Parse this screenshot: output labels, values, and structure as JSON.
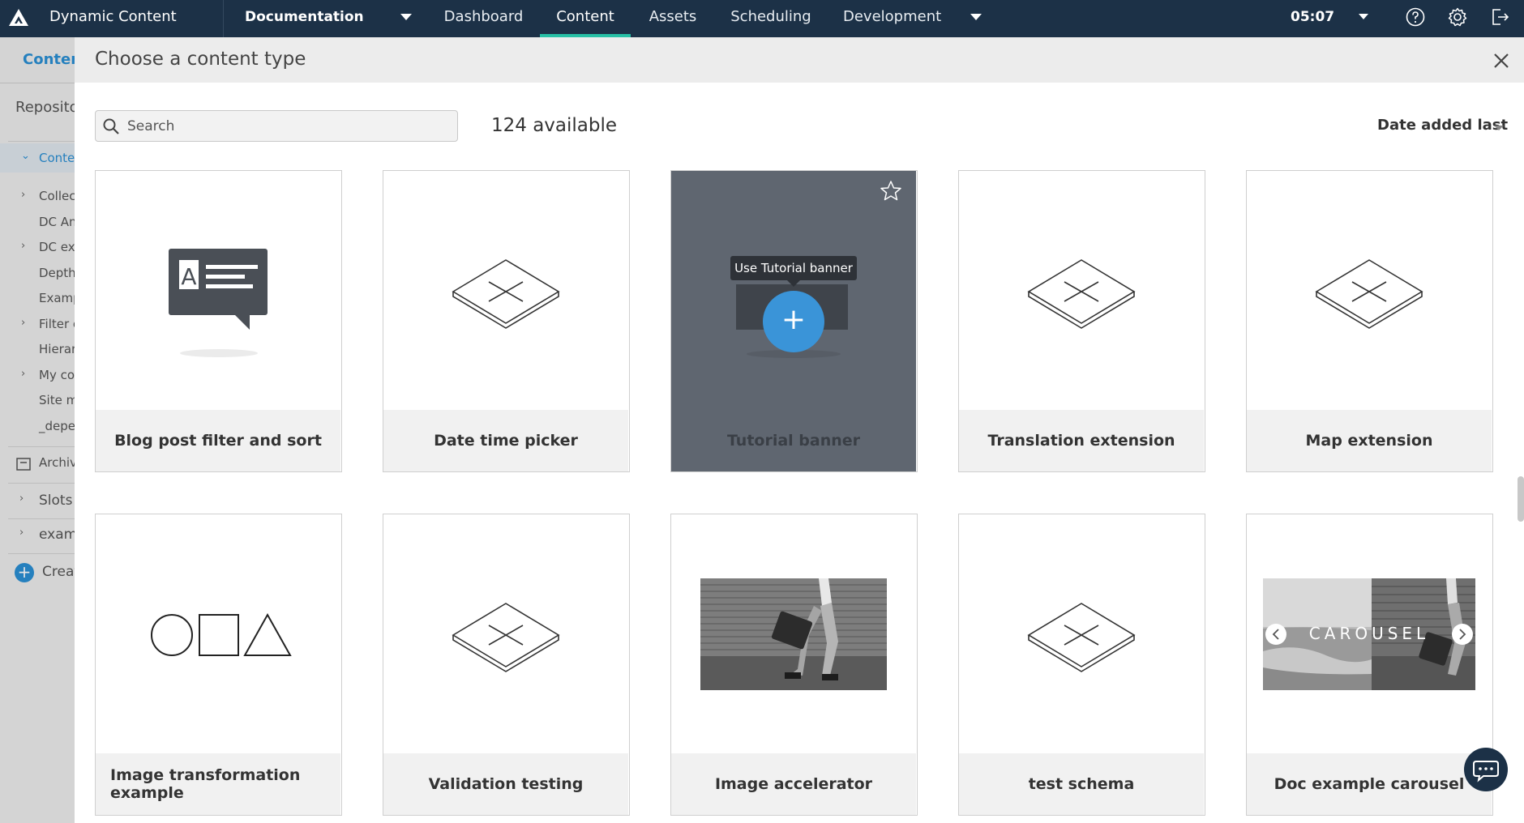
{
  "topbar": {
    "app_title": "Dynamic Content",
    "hub": "Documentation",
    "nav": [
      {
        "label": "Dashboard",
        "active": false
      },
      {
        "label": "Content",
        "active": true
      },
      {
        "label": "Assets",
        "active": false
      },
      {
        "label": "Scheduling",
        "active": false
      },
      {
        "label": "Development",
        "active": false
      }
    ],
    "clock": "05:07",
    "accent_color": "#27c0a5",
    "bar_color": "#1c3147"
  },
  "background_page": {
    "tab": "Content",
    "repository_label": "Repositor",
    "tree": [
      {
        "chev": "⌄",
        "label": "Conte"
      },
      {
        "chev": "›",
        "label": "Collect"
      },
      {
        "chev": "",
        "label": "DC Anı"
      },
      {
        "chev": "›",
        "label": "DC exa"
      },
      {
        "chev": "",
        "label": "Depth"
      },
      {
        "chev": "",
        "label": "Examp"
      },
      {
        "chev": "›",
        "label": "Filter e"
      },
      {
        "chev": "",
        "label": "Hierar"
      },
      {
        "chev": "›",
        "label": "My cor"
      },
      {
        "chev": "",
        "label": "Site m"
      },
      {
        "chev": "",
        "label": "_deper"
      }
    ],
    "archive": "Archiv",
    "slots": "Slots",
    "example": "examp",
    "create": "Creat"
  },
  "modal": {
    "title": "Choose a content type",
    "search_placeholder": "Search",
    "available": "124 available",
    "sort_label": "Date added last",
    "cards": [
      {
        "label": "Blog post filter and sort",
        "icon": "blog-post-icon"
      },
      {
        "label": "Date time picker",
        "icon": "placeholder-icon"
      },
      {
        "label": "Tutorial banner",
        "icon": "banner-icon",
        "hover": true,
        "tooltip": "Use Tutorial banner"
      },
      {
        "label": "Translation extension",
        "icon": "placeholder-icon"
      },
      {
        "label": "Map extension",
        "icon": "placeholder-icon"
      },
      {
        "label": "Image transformation example",
        "icon": "shapes-icon"
      },
      {
        "label": "Validation testing",
        "icon": "placeholder-icon"
      },
      {
        "label": "Image accelerator",
        "icon": "photo-thumbnail"
      },
      {
        "label": "test schema",
        "icon": "placeholder-icon"
      },
      {
        "label": "Doc example carousel",
        "icon": "carousel-thumbnail",
        "carousel_text": "CAROUSEL"
      }
    ]
  }
}
